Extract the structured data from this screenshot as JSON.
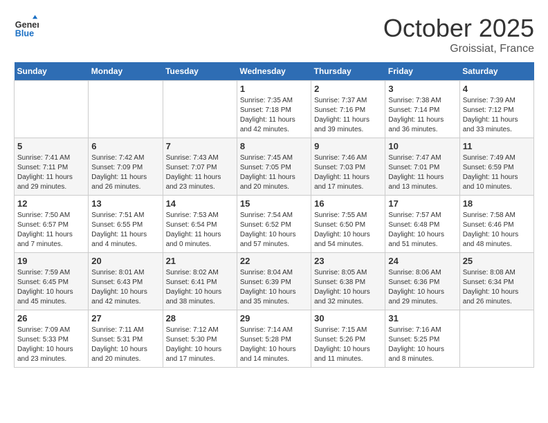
{
  "header": {
    "logo_general": "General",
    "logo_blue": "Blue",
    "month_title": "October 2025",
    "location": "Groissiat, France"
  },
  "days_of_week": [
    "Sunday",
    "Monday",
    "Tuesday",
    "Wednesday",
    "Thursday",
    "Friday",
    "Saturday"
  ],
  "weeks": [
    [
      {
        "day": "",
        "sunrise": "",
        "sunset": "",
        "daylight": ""
      },
      {
        "day": "",
        "sunrise": "",
        "sunset": "",
        "daylight": ""
      },
      {
        "day": "",
        "sunrise": "",
        "sunset": "",
        "daylight": ""
      },
      {
        "day": "1",
        "sunrise": "Sunrise: 7:35 AM",
        "sunset": "Sunset: 7:18 PM",
        "daylight": "Daylight: 11 hours and 42 minutes."
      },
      {
        "day": "2",
        "sunrise": "Sunrise: 7:37 AM",
        "sunset": "Sunset: 7:16 PM",
        "daylight": "Daylight: 11 hours and 39 minutes."
      },
      {
        "day": "3",
        "sunrise": "Sunrise: 7:38 AM",
        "sunset": "Sunset: 7:14 PM",
        "daylight": "Daylight: 11 hours and 36 minutes."
      },
      {
        "day": "4",
        "sunrise": "Sunrise: 7:39 AM",
        "sunset": "Sunset: 7:12 PM",
        "daylight": "Daylight: 11 hours and 33 minutes."
      }
    ],
    [
      {
        "day": "5",
        "sunrise": "Sunrise: 7:41 AM",
        "sunset": "Sunset: 7:11 PM",
        "daylight": "Daylight: 11 hours and 29 minutes."
      },
      {
        "day": "6",
        "sunrise": "Sunrise: 7:42 AM",
        "sunset": "Sunset: 7:09 PM",
        "daylight": "Daylight: 11 hours and 26 minutes."
      },
      {
        "day": "7",
        "sunrise": "Sunrise: 7:43 AM",
        "sunset": "Sunset: 7:07 PM",
        "daylight": "Daylight: 11 hours and 23 minutes."
      },
      {
        "day": "8",
        "sunrise": "Sunrise: 7:45 AM",
        "sunset": "Sunset: 7:05 PM",
        "daylight": "Daylight: 11 hours and 20 minutes."
      },
      {
        "day": "9",
        "sunrise": "Sunrise: 7:46 AM",
        "sunset": "Sunset: 7:03 PM",
        "daylight": "Daylight: 11 hours and 17 minutes."
      },
      {
        "day": "10",
        "sunrise": "Sunrise: 7:47 AM",
        "sunset": "Sunset: 7:01 PM",
        "daylight": "Daylight: 11 hours and 13 minutes."
      },
      {
        "day": "11",
        "sunrise": "Sunrise: 7:49 AM",
        "sunset": "Sunset: 6:59 PM",
        "daylight": "Daylight: 11 hours and 10 minutes."
      }
    ],
    [
      {
        "day": "12",
        "sunrise": "Sunrise: 7:50 AM",
        "sunset": "Sunset: 6:57 PM",
        "daylight": "Daylight: 11 hours and 7 minutes."
      },
      {
        "day": "13",
        "sunrise": "Sunrise: 7:51 AM",
        "sunset": "Sunset: 6:55 PM",
        "daylight": "Daylight: 11 hours and 4 minutes."
      },
      {
        "day": "14",
        "sunrise": "Sunrise: 7:53 AM",
        "sunset": "Sunset: 6:54 PM",
        "daylight": "Daylight: 11 hours and 0 minutes."
      },
      {
        "day": "15",
        "sunrise": "Sunrise: 7:54 AM",
        "sunset": "Sunset: 6:52 PM",
        "daylight": "Daylight: 10 hours and 57 minutes."
      },
      {
        "day": "16",
        "sunrise": "Sunrise: 7:55 AM",
        "sunset": "Sunset: 6:50 PM",
        "daylight": "Daylight: 10 hours and 54 minutes."
      },
      {
        "day": "17",
        "sunrise": "Sunrise: 7:57 AM",
        "sunset": "Sunset: 6:48 PM",
        "daylight": "Daylight: 10 hours and 51 minutes."
      },
      {
        "day": "18",
        "sunrise": "Sunrise: 7:58 AM",
        "sunset": "Sunset: 6:46 PM",
        "daylight": "Daylight: 10 hours and 48 minutes."
      }
    ],
    [
      {
        "day": "19",
        "sunrise": "Sunrise: 7:59 AM",
        "sunset": "Sunset: 6:45 PM",
        "daylight": "Daylight: 10 hours and 45 minutes."
      },
      {
        "day": "20",
        "sunrise": "Sunrise: 8:01 AM",
        "sunset": "Sunset: 6:43 PM",
        "daylight": "Daylight: 10 hours and 42 minutes."
      },
      {
        "day": "21",
        "sunrise": "Sunrise: 8:02 AM",
        "sunset": "Sunset: 6:41 PM",
        "daylight": "Daylight: 10 hours and 38 minutes."
      },
      {
        "day": "22",
        "sunrise": "Sunrise: 8:04 AM",
        "sunset": "Sunset: 6:39 PM",
        "daylight": "Daylight: 10 hours and 35 minutes."
      },
      {
        "day": "23",
        "sunrise": "Sunrise: 8:05 AM",
        "sunset": "Sunset: 6:38 PM",
        "daylight": "Daylight: 10 hours and 32 minutes."
      },
      {
        "day": "24",
        "sunrise": "Sunrise: 8:06 AM",
        "sunset": "Sunset: 6:36 PM",
        "daylight": "Daylight: 10 hours and 29 minutes."
      },
      {
        "day": "25",
        "sunrise": "Sunrise: 8:08 AM",
        "sunset": "Sunset: 6:34 PM",
        "daylight": "Daylight: 10 hours and 26 minutes."
      }
    ],
    [
      {
        "day": "26",
        "sunrise": "Sunrise: 7:09 AM",
        "sunset": "Sunset: 5:33 PM",
        "daylight": "Daylight: 10 hours and 23 minutes."
      },
      {
        "day": "27",
        "sunrise": "Sunrise: 7:11 AM",
        "sunset": "Sunset: 5:31 PM",
        "daylight": "Daylight: 10 hours and 20 minutes."
      },
      {
        "day": "28",
        "sunrise": "Sunrise: 7:12 AM",
        "sunset": "Sunset: 5:30 PM",
        "daylight": "Daylight: 10 hours and 17 minutes."
      },
      {
        "day": "29",
        "sunrise": "Sunrise: 7:14 AM",
        "sunset": "Sunset: 5:28 PM",
        "daylight": "Daylight: 10 hours and 14 minutes."
      },
      {
        "day": "30",
        "sunrise": "Sunrise: 7:15 AM",
        "sunset": "Sunset: 5:26 PM",
        "daylight": "Daylight: 10 hours and 11 minutes."
      },
      {
        "day": "31",
        "sunrise": "Sunrise: 7:16 AM",
        "sunset": "Sunset: 5:25 PM",
        "daylight": "Daylight: 10 hours and 8 minutes."
      },
      {
        "day": "",
        "sunrise": "",
        "sunset": "",
        "daylight": ""
      }
    ]
  ]
}
